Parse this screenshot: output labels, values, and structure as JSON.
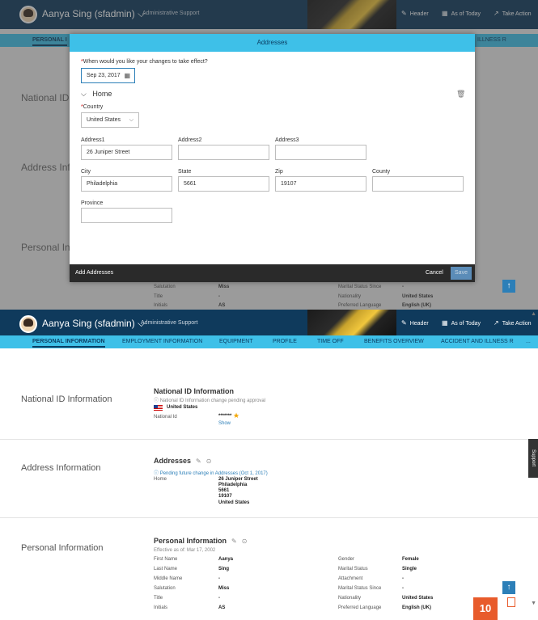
{
  "header": {
    "user_name": "Aanya Sing (sfadmin)",
    "chevron": "⌵",
    "user_role": "Administrative Support",
    "header_link": "Header",
    "as_of": "As of Today",
    "take_action": "Take Action"
  },
  "tabs": [
    "PERSONAL INFORMATION",
    "EMPLOYMENT INFORMATION",
    "EQUIPMENT",
    "PROFILE",
    "TIME OFF",
    "BENEFITS OVERVIEW",
    "ACCIDENT AND ILLNESS R",
    "..."
  ],
  "top_tabs": {
    "first": "PERSONAL I",
    "last": "ILLNESS R"
  },
  "background_sections": [
    "National ID",
    "Address Info",
    "Personal Inf"
  ],
  "modal": {
    "title": "Addresses",
    "effect_question": "When would you like your changes to take effect?",
    "required_mark": "*",
    "date_value": "Sep 23, 2017",
    "section": "Home",
    "country_label": "Country",
    "country_value": "United States",
    "address1_label": "Address1",
    "address1_value": "26 Juniper Street",
    "address2_label": "Address2",
    "address2_value": "",
    "address3_label": "Address3",
    "address3_value": "",
    "city_label": "City",
    "city_value": "Philadelphia",
    "state_label": "State",
    "state_value": "5661",
    "zip_label": "Zip",
    "zip_value": "19107",
    "county_label": "County",
    "county_value": "",
    "province_label": "Province",
    "province_value": "",
    "footer_title": "Add Addresses",
    "cancel_label": "Cancel",
    "save_label": "Save"
  },
  "behind_modal": {
    "salutation_label": "Salutation",
    "salutation_value": "Miss",
    "title_label": "Title",
    "title_value": "-",
    "initials_label": "Initials",
    "initials_value": "AS",
    "ms_since_label": "Marital Status Since",
    "ms_since_value": "-",
    "nationality_label": "Nationality",
    "nationality_value": "United States",
    "pref_lang_label": "Preferred Language",
    "pref_lang_value": "English (UK)"
  },
  "page": {
    "national_id": {
      "section": "National ID Information",
      "title": "National ID Information",
      "pending": "National ID Information change pending approval",
      "country": "United States",
      "label": "National Id",
      "value": "*******",
      "show": "Show"
    },
    "address": {
      "section": "Address Information",
      "title": "Addresses",
      "pending": "Pending future change in Addresses (Oct 1, 2017)",
      "type": "Home",
      "lines": [
        "26 Juniper Street",
        "Philadelphia",
        "5661",
        "19107",
        "United States"
      ]
    },
    "personal": {
      "section": "Personal Information",
      "title": "Personal Information",
      "effective": "Effective as of: Mar 17, 2002",
      "left": [
        {
          "label": "First Name",
          "value": "Aanya"
        },
        {
          "label": "Last Name",
          "value": "Sing"
        },
        {
          "label": "Middle Name",
          "value": "-"
        },
        {
          "label": "Salutation",
          "value": "Miss"
        },
        {
          "label": "Title",
          "value": "-"
        },
        {
          "label": "Initials",
          "value": "AS"
        }
      ],
      "right": [
        {
          "label": "Gender",
          "value": "Female"
        },
        {
          "label": "Marital Status",
          "value": "Single"
        },
        {
          "label": "Attachment",
          "value": "-"
        },
        {
          "label": "Marital Status Since",
          "value": "-"
        },
        {
          "label": "Nationality",
          "value": "United States"
        },
        {
          "label": "Preferred Language",
          "value": "English (UK)"
        }
      ]
    },
    "support": "Support",
    "badge": "10"
  },
  "icons": {
    "pencil": "✎",
    "history": "⊙",
    "info": "ⓘ",
    "calendar": "▦",
    "trash": "🗑",
    "up": "↑",
    "chevron_down": "⌵",
    "star": "★",
    "external": "↗"
  }
}
